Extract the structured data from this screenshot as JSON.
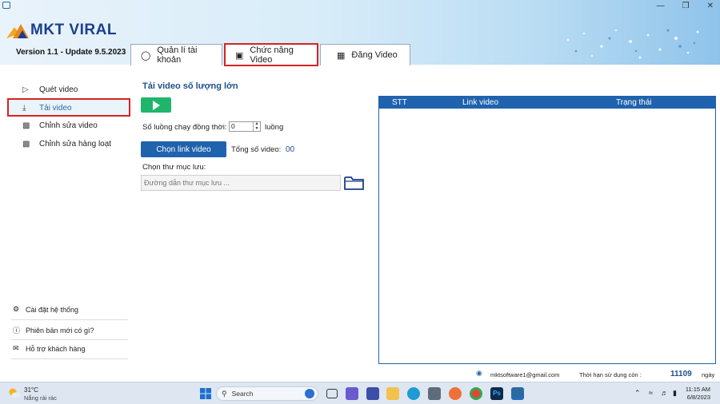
{
  "app": {
    "name": "MKT VIRAL",
    "version": "Version 1.1 - Update 9.5.2023"
  },
  "tabs": [
    {
      "label": "Quản lí tài khoản"
    },
    {
      "label": "Chức năng Video"
    },
    {
      "label": "Đăng Video"
    }
  ],
  "sidebar": {
    "items": [
      {
        "label": "Quét video",
        "icon": "video-screen-icon"
      },
      {
        "label": "Tải video",
        "icon": "download-icon"
      },
      {
        "label": "Chỉnh sửa video",
        "icon": "monitor-edit-icon"
      },
      {
        "label": "Chỉnh sửa hàng loạt",
        "icon": "monitor-batch-icon"
      }
    ],
    "bottom": [
      {
        "label": "Cài đặt hệ thống",
        "icon": "gear-icon"
      },
      {
        "label": "Phiên bản mới có gì?",
        "icon": "info-icon"
      },
      {
        "label": "Hỗ trợ khách hàng",
        "icon": "chat-icon"
      }
    ]
  },
  "main": {
    "title": "Tải video số lượng lớn",
    "threads_label": "Số luồng chạy đồng thời:",
    "threads_value": "0",
    "threads_unit": "luồng",
    "choose_button": "Chọn link video",
    "total_label": "Tổng số video:",
    "total_value": "00",
    "folder_label": "Chọn thư mục lưu:",
    "folder_placeholder": "Đường dẫn thư mục lưu ..."
  },
  "table": {
    "columns": [
      "STT",
      "Link video",
      "Trạng thái"
    ],
    "rows": []
  },
  "footer": {
    "email": "mktsoftware1@gmail.com",
    "expiry_label": "Thời hạn sử dụng còn :",
    "days": "11109",
    "days_unit": "ngày"
  },
  "taskbar": {
    "temperature": "31°C",
    "weather": "Nắng rải rác",
    "search": "Search",
    "time": "11:15 AM",
    "date": "6/8/2023"
  },
  "colors": {
    "accent": "#1f62ad",
    "play": "#1fb56a",
    "highlight": "#d42424",
    "title": "#1d4f8c"
  }
}
